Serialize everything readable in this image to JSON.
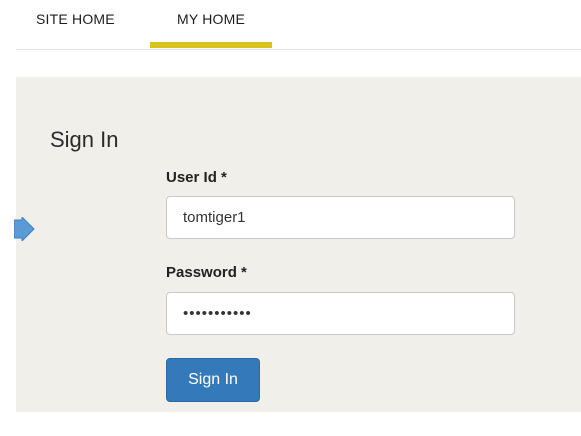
{
  "nav": {
    "tabs": [
      {
        "label": "SITE HOME",
        "active": false
      },
      {
        "label": "MY HOME",
        "active": true
      }
    ],
    "active_color": "#d8c41c"
  },
  "signin": {
    "title": "Sign In",
    "user_label": "User Id *",
    "user_value": "tomtiger1",
    "password_label": "Password *",
    "password_value": "•••••••••••",
    "button_label": "Sign In",
    "button_color": "#3479b9",
    "panel_color": "#f0efe9"
  },
  "pointer": {
    "icon": "arrow-right-icon",
    "color": "#5b9bd5"
  }
}
